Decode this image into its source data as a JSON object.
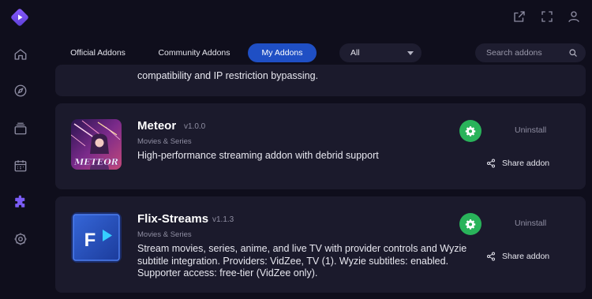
{
  "tabs": [
    {
      "label": "Official Addons",
      "active": false
    },
    {
      "label": "Community Addons",
      "active": false
    },
    {
      "label": "My Addons",
      "active": true
    }
  ],
  "filter": {
    "selected": "All"
  },
  "search": {
    "placeholder": "Search addons"
  },
  "sidebar": {
    "icons": [
      "home-icon",
      "compass-icon",
      "library-icon",
      "calendar-icon",
      "puzzle-icon",
      "settings-icon"
    ],
    "active": "puzzle-icon"
  },
  "topbar": {
    "icons": [
      "external-link-icon",
      "fullscreen-icon",
      "user-icon"
    ]
  },
  "addons": [
    {
      "description": "compatibility and IP restriction bypassing."
    },
    {
      "name": "Meteor",
      "version": "v1.0.0",
      "category": "Movies & Series",
      "description": "High-performance streaming addon with debrid support",
      "logo_text": "METEOR",
      "uninstall_label": "Uninstall",
      "share_label": "Share addon"
    },
    {
      "name": "Flix-Streams",
      "version": "v1.1.3",
      "category": "Movies & Series",
      "description": "Stream movies, series, anime, and live TV with provider controls and Wyzie subtitle integration. Providers: VidZee, TV (1). Wyzie subtitles: enabled. Supporter access: free-tier (VidZee only).",
      "logo_text": "F",
      "uninstall_label": "Uninstall",
      "share_label": "Share addon"
    }
  ],
  "colors": {
    "background": "#0f0e1c",
    "card": "#1b1a2c",
    "accent": "#1f4fc4",
    "configure": "#29b35a",
    "active_nav": "#7b5cf5"
  }
}
